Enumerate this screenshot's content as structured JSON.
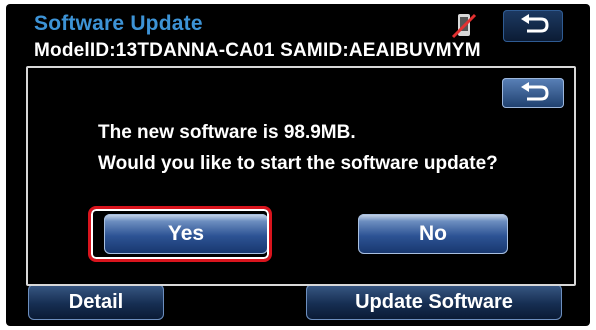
{
  "header": {
    "title": "Software Update",
    "status_icon": "no-phone-icon",
    "back_icon": "return-arrow-icon"
  },
  "info": {
    "model_line": "ModelID:13TDANNA-CA01   SAMID:AEAIBUVMYM"
  },
  "background_buttons": {
    "detail_label": "Detail",
    "update_label": "Update Software"
  },
  "dialog": {
    "back_icon": "return-arrow-icon",
    "message_line1": "The new software is 98.9MB.",
    "message_line2": "Would you like to start the software update?",
    "yes_label": "Yes",
    "no_label": "No"
  },
  "colors": {
    "title": "#3d93d6",
    "highlight": "#d9141d",
    "button_blue": "#2d5394"
  }
}
